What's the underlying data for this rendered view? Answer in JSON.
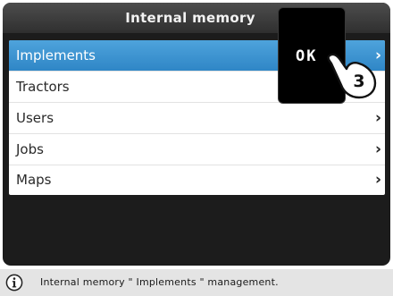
{
  "header": {
    "title": "Internal memory"
  },
  "menu": {
    "items": [
      {
        "label": "Implements",
        "selected": true,
        "has_chevron": true
      },
      {
        "label": "Tractors",
        "selected": false,
        "has_chevron": false
      },
      {
        "label": "Users",
        "selected": false,
        "has_chevron": true
      },
      {
        "label": "Jobs",
        "selected": false,
        "has_chevron": true
      },
      {
        "label": "Maps",
        "selected": false,
        "has_chevron": true
      }
    ],
    "chevron": "›"
  },
  "ok_button": {
    "label": "OK",
    "callout_number": "3"
  },
  "status": {
    "icon": "info-icon",
    "text": "Internal memory \" Implements \" management."
  },
  "colors": {
    "selected_row": "#3a93d3",
    "screen_background": "#1c1c1c",
    "status_background": "#e4e4e4"
  }
}
